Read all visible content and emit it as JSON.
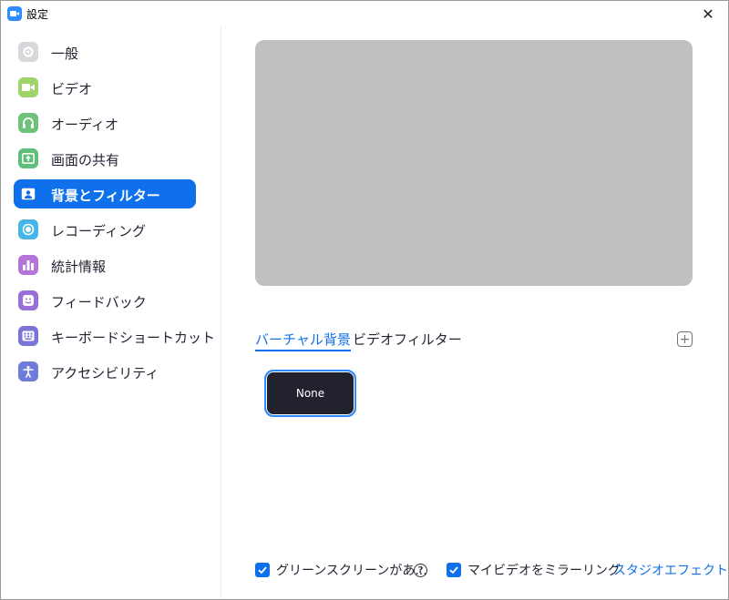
{
  "window": {
    "title": "設定",
    "close_glyph": "✕"
  },
  "sidebar": {
    "items": [
      {
        "label": "一般",
        "icon": "gear-icon",
        "color": "#d8d8dc",
        "active": false
      },
      {
        "label": "ビデオ",
        "icon": "video-camera-icon",
        "color": "#9ed46b",
        "active": false
      },
      {
        "label": "オーディオ",
        "icon": "headphones-icon",
        "color": "#6ec27a",
        "active": false
      },
      {
        "label": "画面の共有",
        "icon": "share-screen-icon",
        "color": "#5fbf7a",
        "active": false
      },
      {
        "label": "背景とフィルター",
        "icon": "background-portrait-icon",
        "color": "#ffffff",
        "active": true
      },
      {
        "label": "レコーディング",
        "icon": "record-icon",
        "color": "#45b6e8",
        "active": false
      },
      {
        "label": "統計情報",
        "icon": "bar-chart-icon",
        "color": "#b574d8",
        "active": false
      },
      {
        "label": "フィードバック",
        "icon": "smiley-icon",
        "color": "#9a6ed8",
        "active": false
      },
      {
        "label": "キーボードショートカット",
        "icon": "keyboard-icon",
        "color": "#7b74d8",
        "active": false
      },
      {
        "label": "アクセシビリティ",
        "icon": "accessibility-icon",
        "color": "#6f7bd8",
        "active": false
      }
    ]
  },
  "main": {
    "tabs": [
      {
        "label": "バーチャル背景",
        "active": true
      },
      {
        "label": "ビデオフィルター",
        "active": false
      }
    ],
    "add_glyph": "+",
    "backgrounds": [
      {
        "label": "None",
        "selected": true
      }
    ],
    "footer": {
      "green_screen_label": "グリーンスクリーンがあ...",
      "green_screen_checked": true,
      "help_glyph": "?",
      "mirror_label": "マイビデオをミラーリング",
      "mirror_checked": true,
      "studio_effects_label": "スタジオエフェクト（β"
    }
  },
  "colors": {
    "accent": "#0e71eb",
    "preview_bg": "#c0c0c0",
    "tile_bg": "#22222e"
  }
}
